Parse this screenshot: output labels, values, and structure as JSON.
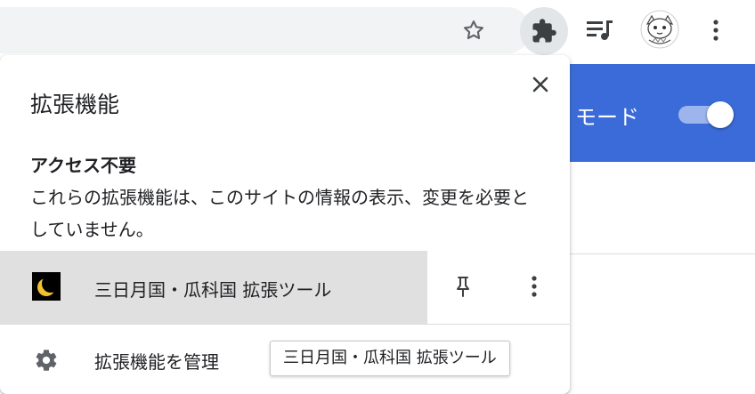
{
  "toolbar": {
    "bookmark_icon": "star-outline-icon",
    "extensions_icon": "puzzle-piece-icon",
    "media_icon": "queue-music-icon",
    "avatar_icon": "profile-avatar",
    "menu_icon": "vertical-dots-icon"
  },
  "page": {
    "mode_label": "モード",
    "toggle_state": "on",
    "banner_color": "#3a6bd8"
  },
  "popup": {
    "title": "拡張機能",
    "close_icon": "close-icon",
    "section_heading": "アクセス不要",
    "section_desc": "これらの拡張機能は、このサイトの情報の表示、変更を必要としていません。",
    "extensions": [
      {
        "name": "三日月国・瓜科国 拡張ツール",
        "icon": "crescent-moon-icon",
        "pin_icon": "pin-icon",
        "menu_icon": "vertical-dots-icon"
      }
    ],
    "manage_label": "拡張機能を管理",
    "manage_icon": "gear-icon"
  },
  "tooltip": {
    "text": "三日月国・瓜科国 拡張ツール"
  }
}
